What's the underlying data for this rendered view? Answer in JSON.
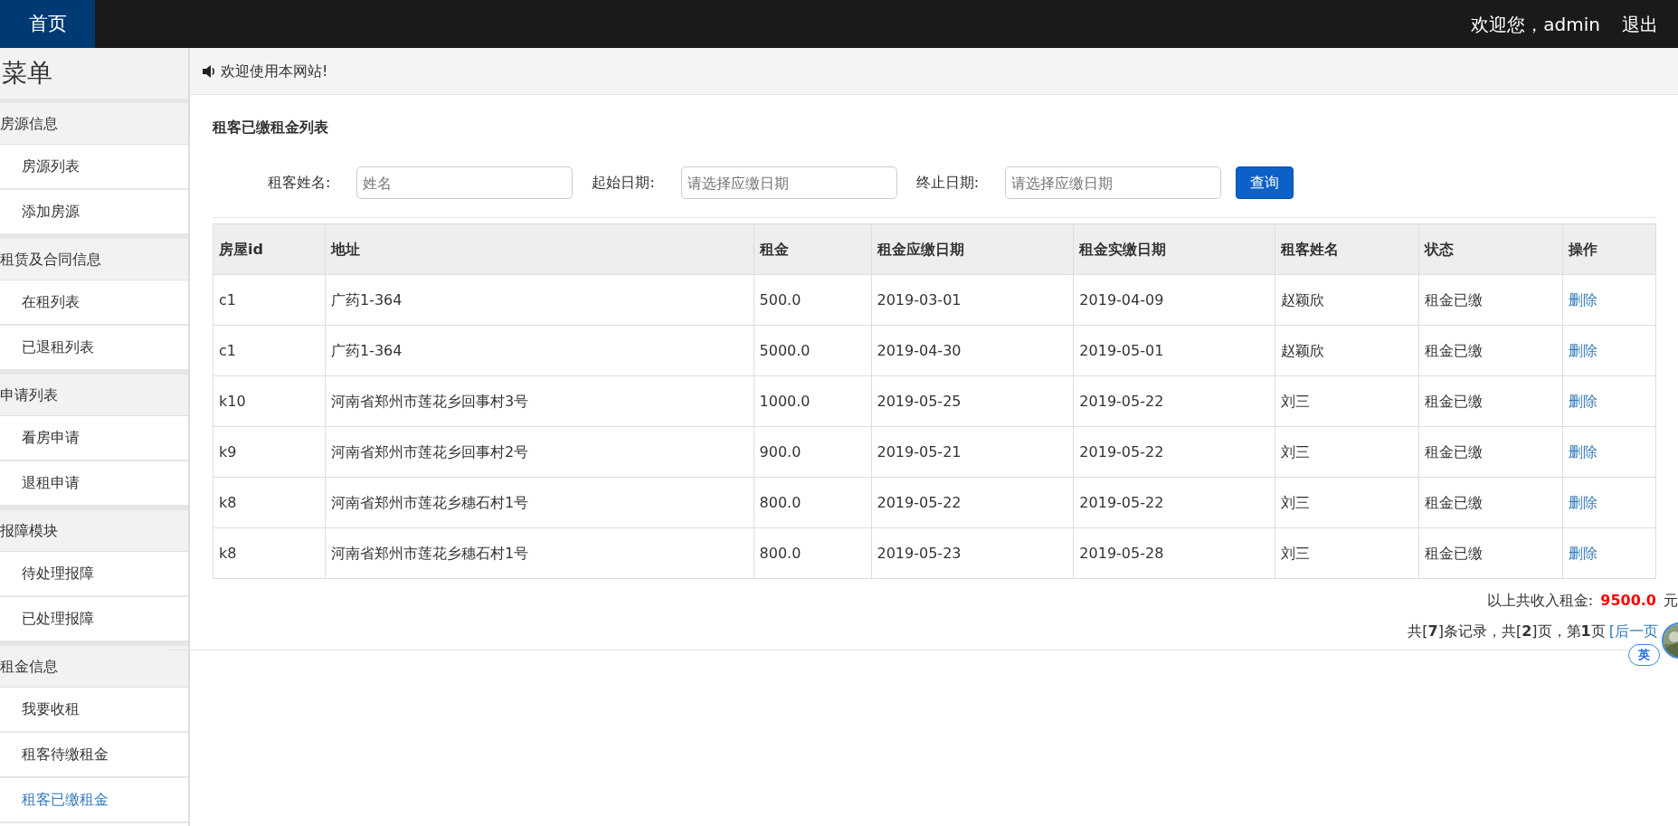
{
  "topbar": {
    "home": "首页",
    "welcome": "欢迎您，admin",
    "logout": "退出"
  },
  "sidebar": {
    "title": "菜单",
    "groups": [
      {
        "label": "房源信息",
        "children": [
          {
            "label": "房源列表",
            "selected": false
          },
          {
            "label": "添加房源",
            "selected": false
          }
        ]
      },
      {
        "label": "租赁及合同信息",
        "children": [
          {
            "label": "在租列表",
            "selected": false
          },
          {
            "label": "已退租列表",
            "selected": false
          }
        ]
      },
      {
        "label": "申请列表",
        "children": [
          {
            "label": "看房申请",
            "selected": false
          },
          {
            "label": "退租申请",
            "selected": false
          }
        ]
      },
      {
        "label": "报障模块",
        "children": [
          {
            "label": "待处理报障",
            "selected": false
          },
          {
            "label": "已处理报障",
            "selected": false
          }
        ]
      },
      {
        "label": "租金信息",
        "children": [
          {
            "label": "我要收租",
            "selected": false
          },
          {
            "label": "租客待缴租金",
            "selected": false
          },
          {
            "label": "租客已缴租金",
            "selected": true
          }
        ]
      }
    ]
  },
  "notice": "欢迎使用本网站!",
  "panel_title": "租客已缴租金列表",
  "filters": [
    {
      "label": "租客姓名:",
      "placeholder": "姓名"
    },
    {
      "label": "起始日期:",
      "placeholder": "请选择应缴日期"
    },
    {
      "label": "终止日期:",
      "placeholder": "请选择应缴日期"
    }
  ],
  "search_button": "查询",
  "table": {
    "columns": [
      "房屋id",
      "地址",
      "租金",
      "租金应缴日期",
      "租金实缴日期",
      "租客姓名",
      "状态",
      "操作"
    ],
    "rows": [
      [
        "c1",
        "广药1-364",
        "500.0",
        "2019-03-01",
        "2019-04-09",
        "赵颖欣",
        "租金已缴",
        "删除"
      ],
      [
        "c1",
        "广药1-364",
        "5000.0",
        "2019-04-30",
        "2019-05-01",
        "赵颖欣",
        "租金已缴",
        "删除"
      ],
      [
        "k10",
        "河南省郑州市莲花乡回事村3号",
        "1000.0",
        "2019-05-25",
        "2019-05-22",
        "刘三",
        "租金已缴",
        "删除"
      ],
      [
        "k9",
        "河南省郑州市莲花乡回事村2号",
        "900.0",
        "2019-05-21",
        "2019-05-22",
        "刘三",
        "租金已缴",
        "删除"
      ],
      [
        "k8",
        "河南省郑州市莲花乡穗石村1号",
        "800.0",
        "2019-05-22",
        "2019-05-22",
        "刘三",
        "租金已缴",
        "删除"
      ],
      [
        "k8",
        "河南省郑州市莲花乡穗石村1号",
        "800.0",
        "2019-05-23",
        "2019-05-28",
        "刘三",
        "租金已缴",
        "删除"
      ]
    ]
  },
  "total": {
    "label": "以上共收入租金:",
    "amount": "9500.0",
    "unit": "元"
  },
  "pagination": {
    "summary": "共[**7**]条记录，共[**2**]页，第**1**页",
    "next": "[后一页"
  },
  "ime": {
    "label": "英"
  }
}
